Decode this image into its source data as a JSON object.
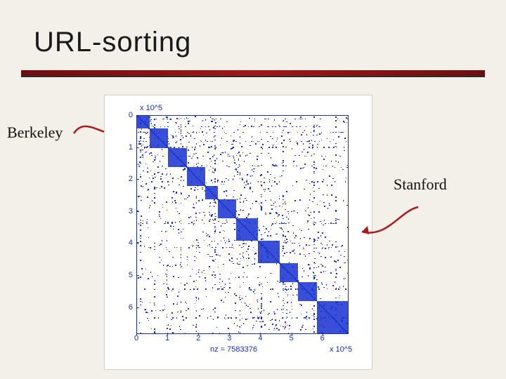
{
  "title": "URL-sorting",
  "label_left": "Berkeley",
  "label_right": "Stanford",
  "chart_data": {
    "type": "scatter",
    "title": "",
    "xlabel": "",
    "ylabel": "",
    "x_scale_label": "x 10^5",
    "y_scale_label": "x 10^5",
    "xlim": [
      0,
      6.8
    ],
    "ylim": [
      0,
      6.8
    ],
    "xticks": [
      0,
      1,
      2,
      3,
      4,
      5,
      6
    ],
    "yticks": [
      0,
      1,
      2,
      3,
      4,
      5,
      6
    ],
    "nz_label": "nz = 7583376",
    "nz_value": 7583376,
    "description": "Sparse adjacency / link matrix spy plot after URL-sorting. Strong diagonal with dense square blocks along it (community structure), off-diagonal sparse scatter, and horizontal/vertical stripes near high-degree rows/columns.",
    "diagonal_blocks_approx_e5": [
      {
        "start": 0.0,
        "end": 0.4
      },
      {
        "start": 0.4,
        "end": 1.0
      },
      {
        "start": 1.0,
        "end": 1.6
      },
      {
        "start": 1.6,
        "end": 2.2
      },
      {
        "start": 2.2,
        "end": 2.6
      },
      {
        "start": 2.6,
        "end": 3.2
      },
      {
        "start": 3.2,
        "end": 3.9
      },
      {
        "start": 3.9,
        "end": 4.6
      },
      {
        "start": 4.6,
        "end": 5.2
      },
      {
        "start": 5.2,
        "end": 5.8
      },
      {
        "start": 5.8,
        "end": 6.8
      }
    ],
    "annotations": [
      {
        "text": "Berkeley",
        "points_to_region_e5": {
          "row": 0.6,
          "col": 0.6
        }
      },
      {
        "text": "Stanford",
        "points_to_region_e5": {
          "row": 3.2,
          "col": 3.2
        }
      }
    ]
  }
}
